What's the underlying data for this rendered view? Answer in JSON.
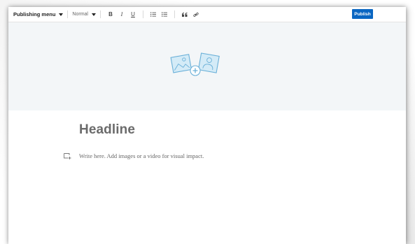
{
  "toolbar": {
    "publishing_menu_label": "Publishing menu",
    "style_select_value": "Normal",
    "bold_label": "B",
    "italic_label": "I",
    "underline_label": "U",
    "publish_label": "Publish"
  },
  "cover": {
    "icon": "add-images-icon"
  },
  "editor": {
    "headline_placeholder": "Headline",
    "body_placeholder": "Write here. Add images or a video for visual impact."
  },
  "colors": {
    "accent": "#0a66c2",
    "cover_bg": "#f3f6f8",
    "icon_fill": "#c9e4f3",
    "icon_stroke": "#6ab0d8"
  }
}
